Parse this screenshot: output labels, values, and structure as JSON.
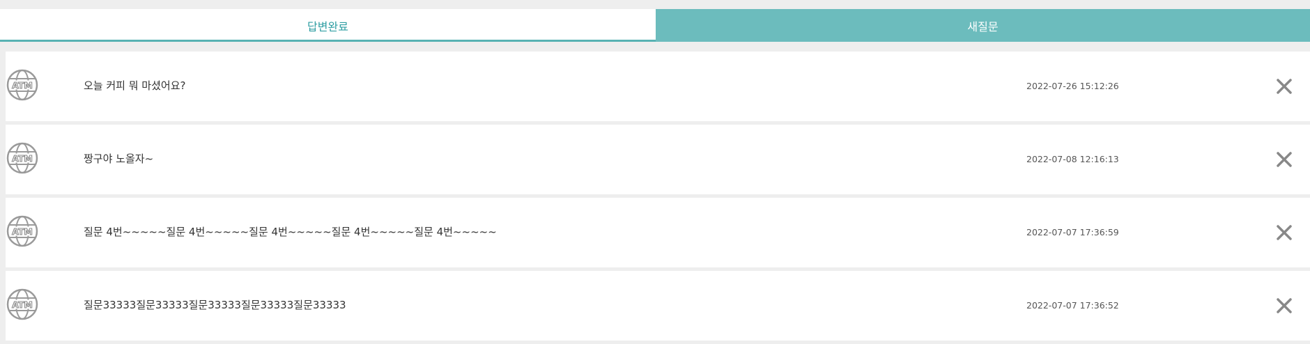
{
  "tabs": {
    "answered_label": "답변완료",
    "new_label": "새질문"
  },
  "icons": {
    "row_icon": "atm-globe-icon",
    "row_icon_text": "ATM",
    "delete_icon": "close-icon"
  },
  "colors": {
    "accent": "#6cbcbd",
    "accent_text": "#2f9ea3"
  },
  "questions": [
    {
      "title": "오늘 커피 뭐 마셨어요?",
      "date": "2022-07-26 15:12:26"
    },
    {
      "title": "짱구야 노올자~",
      "date": "2022-07-08 12:16:13"
    },
    {
      "title": "질문 4번~~~~~질문 4번~~~~~질문 4번~~~~~질문 4번~~~~~질문 4번~~~~~",
      "date": "2022-07-07 17:36:59"
    },
    {
      "title": "질문33333질문33333질문33333질문33333질문33333",
      "date": "2022-07-07 17:36:52"
    }
  ]
}
